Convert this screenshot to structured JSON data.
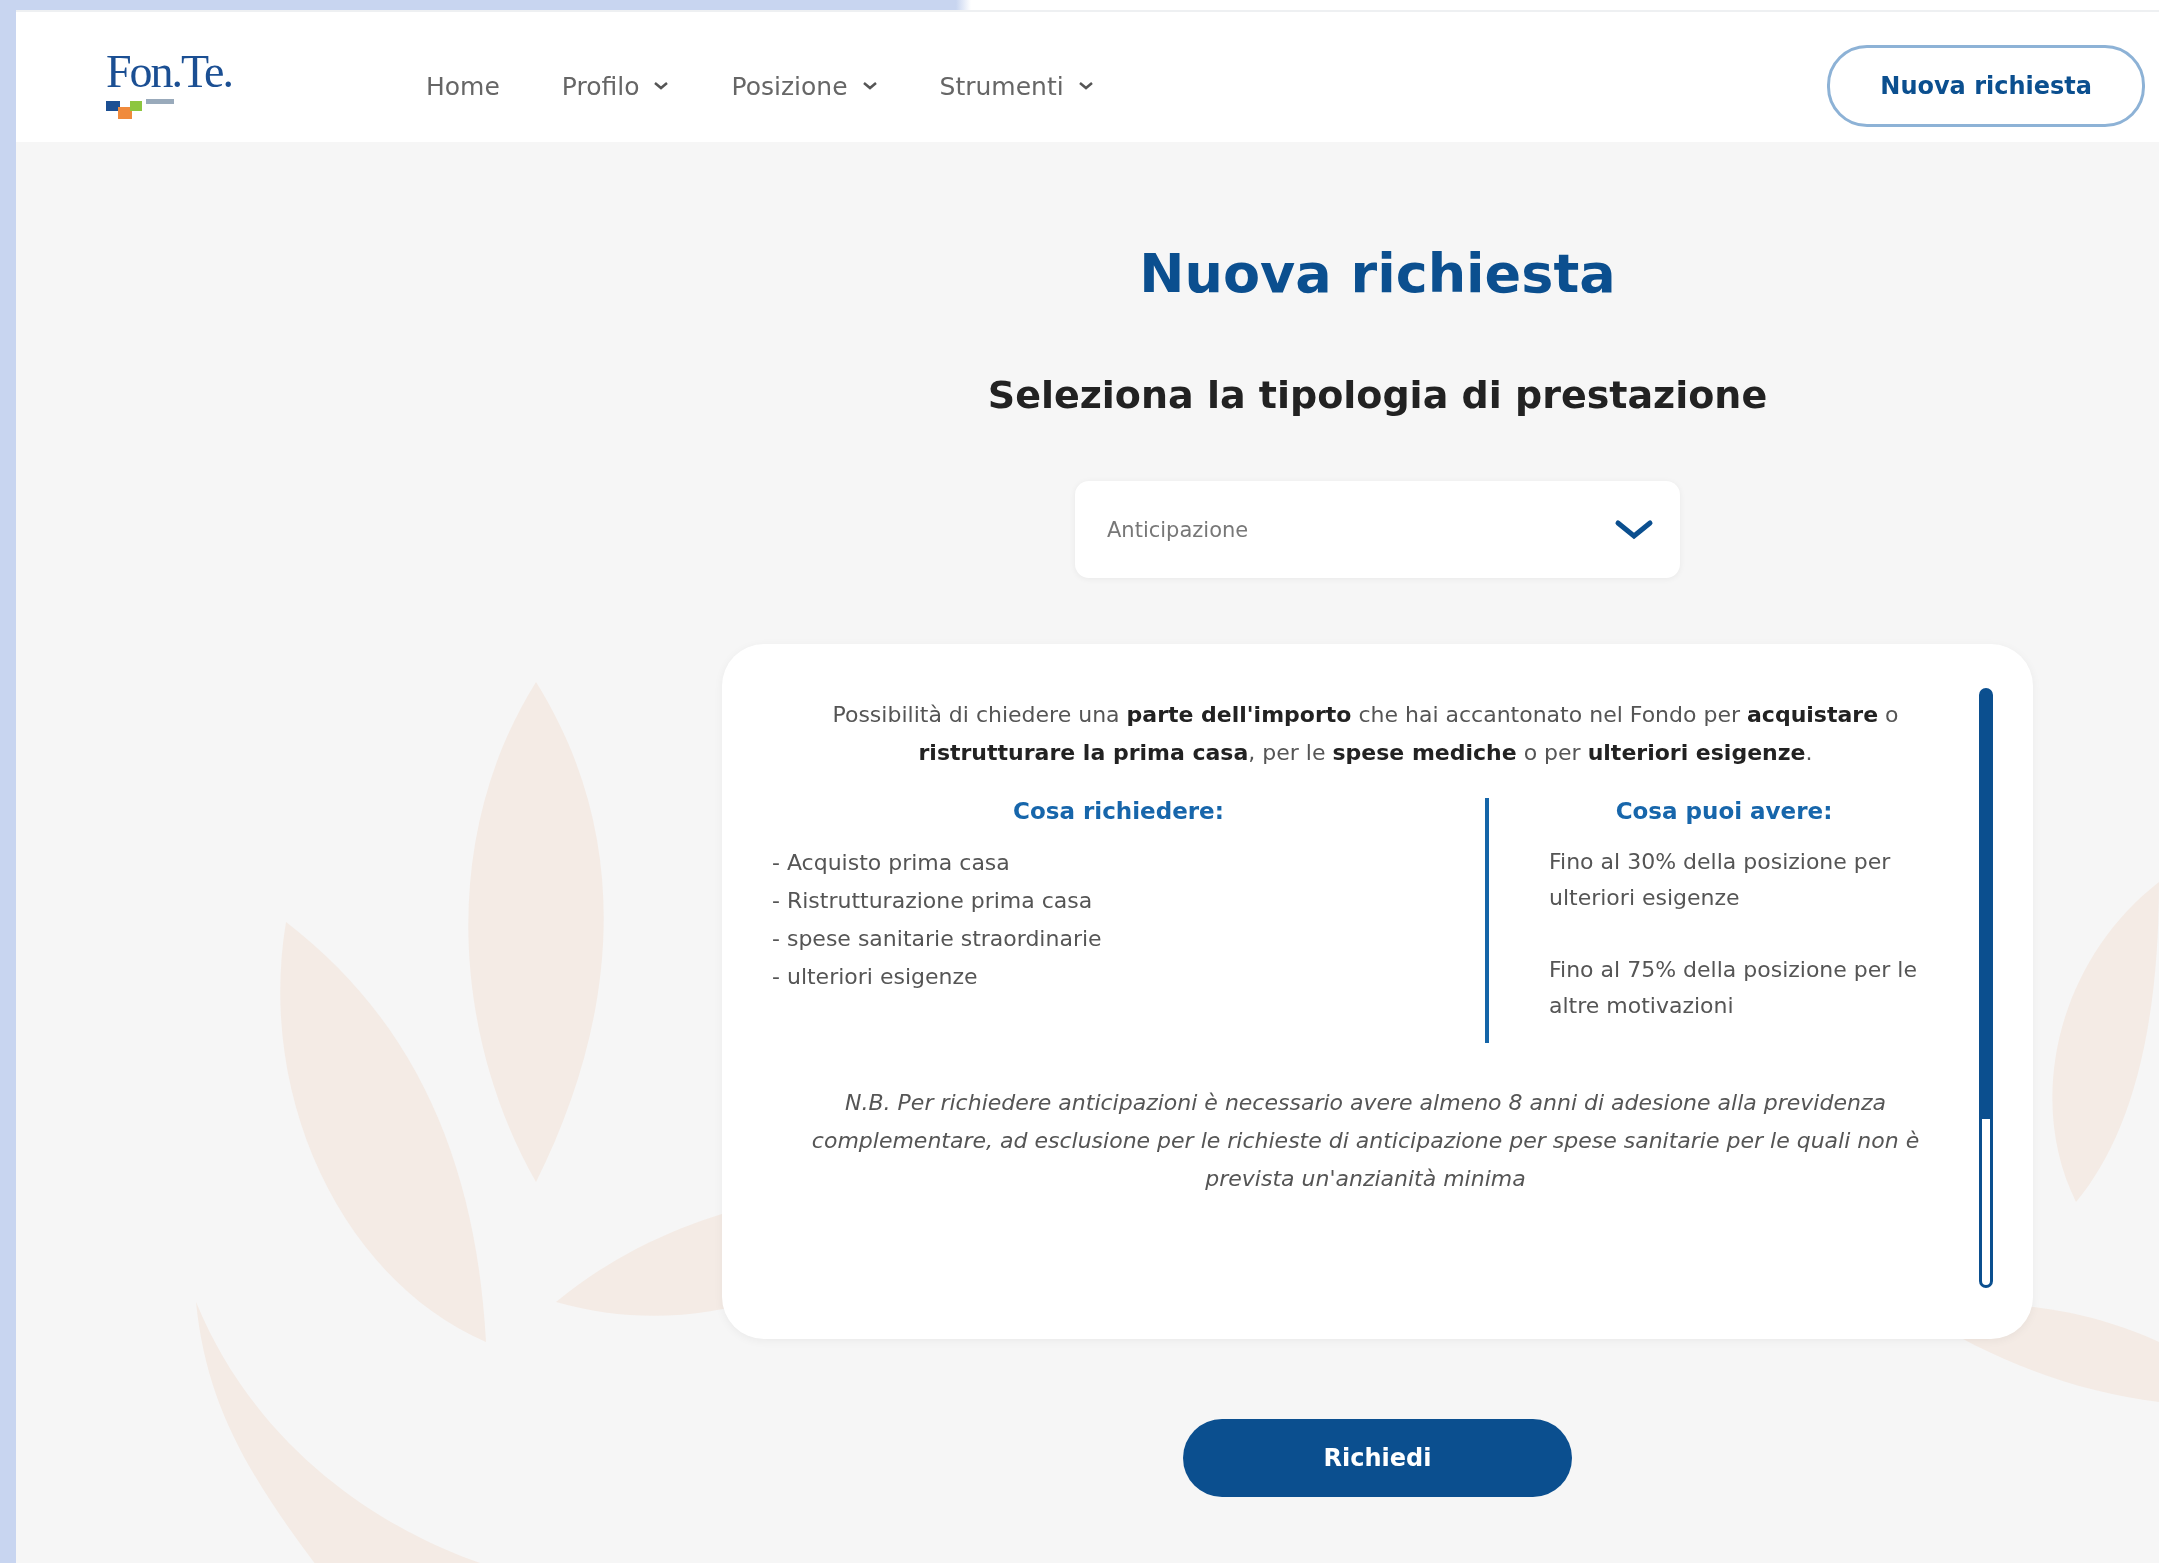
{
  "logo": {
    "text": "Fon.Te."
  },
  "nav": [
    {
      "label": "Home",
      "has_menu": false
    },
    {
      "label": "Profilo",
      "has_menu": true
    },
    {
      "label": "Posizione",
      "has_menu": true
    },
    {
      "label": "Strumenti",
      "has_menu": true
    }
  ],
  "header_button": "Nuova richiesta",
  "title": "Nuova richiesta",
  "subtitle": "Seleziona la tipologia di prestazione",
  "select": {
    "value": "Anticipazione"
  },
  "card": {
    "description": "Possibilità di chiedere una **parte dell'importo** che hai accantonato nel Fondo per **acquistare** o **ristrutturare la prima casa**, per le **spese mediche** o per **ulteriori esigenze**.",
    "left": {
      "heading": "Cosa richiedere:",
      "items": [
        "- Acquisto prima casa",
        "- Ristrutturazione prima casa",
        "- spese sanitarie straordinarie",
        "- ulteriori esigenze"
      ]
    },
    "right": {
      "heading": "Cosa puoi avere:",
      "items": [
        "Fino al 30% della posizione per ulteriori esigenze",
        "Fino al 75% della posizione per le altre motivazioni"
      ]
    },
    "note": "N.B. Per richiedere anticipazioni è necessario avere almeno 8 anni di adesione alla previdenza complementare, ad esclusione per le richieste di anticipazione per spese sanitarie per le quali non è prevista un'anzianità minima"
  },
  "submit_button": "Richiedi"
}
